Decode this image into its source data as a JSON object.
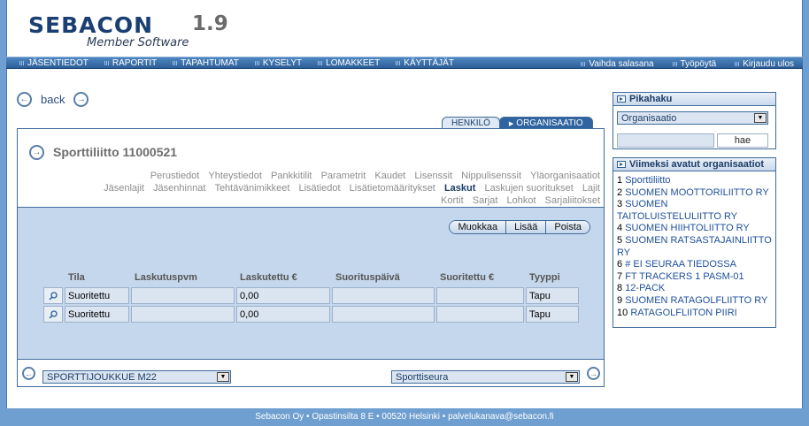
{
  "app": {
    "logo": "SEBACON",
    "version": "1.9",
    "subtitle": "Member Software"
  },
  "nav": {
    "left": [
      "JÄSENTIEDOT",
      "RAPORTIT",
      "TAPAHTUMAT",
      "KYSELYT",
      "LOMAKKEET",
      "KÄYTTÄJÄT"
    ],
    "right": [
      "Vaihda salasana",
      "Työpöytä",
      "Kirjaudu ulos"
    ]
  },
  "back": {
    "label": "back"
  },
  "tabs": {
    "person": "HENKILÖ",
    "org": "ORGANISAATIO"
  },
  "panel": {
    "title": "Sporttiliitto 11000521",
    "subnav": [
      "Perustiedot",
      "Yhteystiedot",
      "Pankkitilit",
      "Parametrit",
      "Kaudet",
      "Lisenssit",
      "Nippulisenssit",
      "Yläorganisaatiot",
      "Jäsenlajit",
      "Jäsenhinnat",
      "Tehtävänimikkeet",
      "Lisätiedot",
      "Lisätietomääritykset",
      "Laskut",
      "Laskujen suoritukset",
      "Lajit",
      "Kortit",
      "Sarjat",
      "Lohkot",
      "Sarjaliitokset"
    ],
    "active_subnav": "Laskut",
    "actions": {
      "edit": "Muokkaa",
      "add": "Lisää",
      "delete": "Poista"
    },
    "table": {
      "headers": [
        "Tila",
        "Laskutuspvm",
        "Laskutettu €",
        "Suorituspäivä",
        "Suoritettu €",
        "Tyyppi"
      ],
      "rows": [
        [
          "Suoritettu",
          "",
          "0,00",
          "",
          "",
          "Tapu"
        ],
        [
          "Suoritettu",
          "",
          "0,00",
          "",
          "",
          "Tapu"
        ]
      ]
    },
    "footer": {
      "left_select": "SPORTTIJOUKKUE M22",
      "right_select": "Sporttiseura"
    }
  },
  "pikahaku": {
    "title": "Pikahaku",
    "select": "Organisaatio",
    "input": "",
    "button": "hae"
  },
  "recent": {
    "title": "Viimeksi avatut organisaatiot",
    "items": [
      {
        "num": "1",
        "name": "Sporttiliitto"
      },
      {
        "num": "2",
        "name": "SUOMEN MOOTTORILIITTO RY"
      },
      {
        "num": "3",
        "name": "SUOMEN TAITOLUISTELULIITTO RY"
      },
      {
        "num": "4",
        "name": "SUOMEN HIIHTOLIITTO RY"
      },
      {
        "num": "5",
        "name": "SUOMEN RATSASTAJAINLIITTO RY"
      },
      {
        "num": "6",
        "name": "# EI SEURAA TIEDOSSA"
      },
      {
        "num": "7",
        "name": "FT TRACKERS 1 PASM-01"
      },
      {
        "num": "8",
        "name": "12-PACK"
      },
      {
        "num": "9",
        "name": "SUOMEN RATAGOLFLIITTO RY"
      },
      {
        "num": "10",
        "name": "RATAGOLFLIITON PIIRI"
      }
    ]
  },
  "footer": "Sebacon Oy • Opastinsilta 8 E • 00520 Helsinki • palvelukanava@sebacon.fi"
}
